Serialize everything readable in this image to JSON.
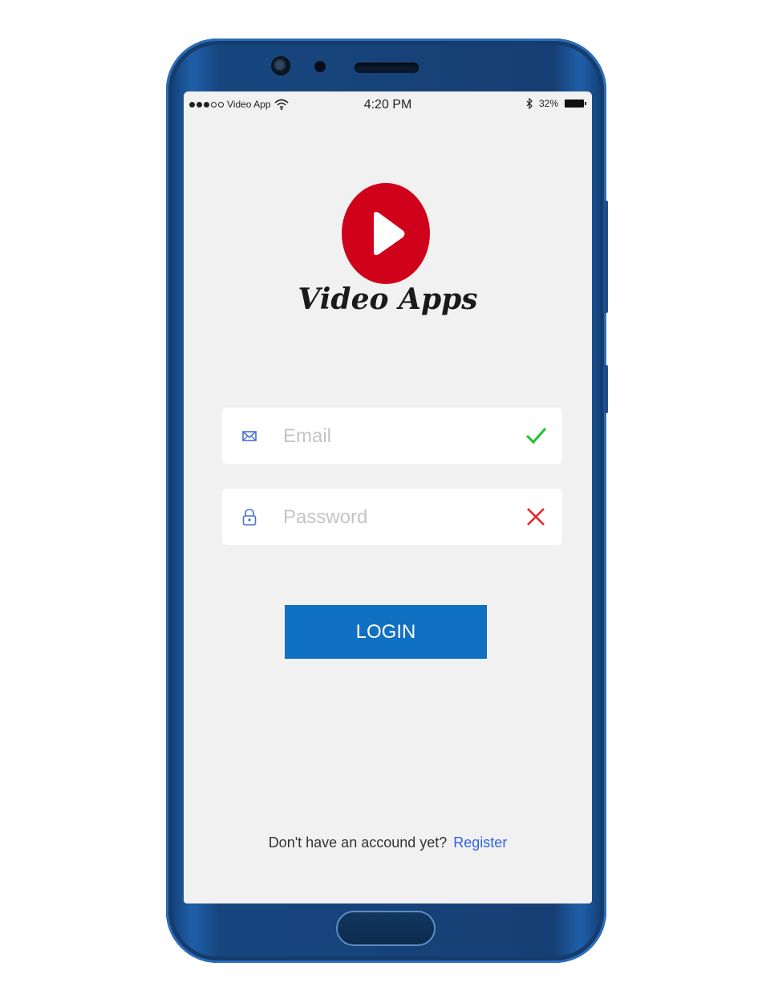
{
  "status_bar": {
    "carrier": "Video App",
    "time": "4:20 PM",
    "battery": "32%",
    "signal_dots_filled": 3,
    "signal_dots_total": 5,
    "icons": [
      "wifi-icon",
      "bluetooth-icon",
      "battery-icon"
    ]
  },
  "app": {
    "logo_icon": "play-icon",
    "title": "Video Apps",
    "brand_color": "#d0021b"
  },
  "form": {
    "email": {
      "placeholder": "Email",
      "value": "",
      "icon": "mail-icon",
      "status_icon": "check-icon",
      "status_color": "#22c32c"
    },
    "password": {
      "placeholder": "Password",
      "value": "",
      "icon": "lock-icon",
      "status_icon": "cross-icon",
      "status_color": "#e8262b"
    },
    "login_label": "LOGIN",
    "login_color": "#1070c2"
  },
  "footer": {
    "prompt": "Don't have an accound yet?",
    "register_label": "Register",
    "link_color": "#2f63e6"
  }
}
